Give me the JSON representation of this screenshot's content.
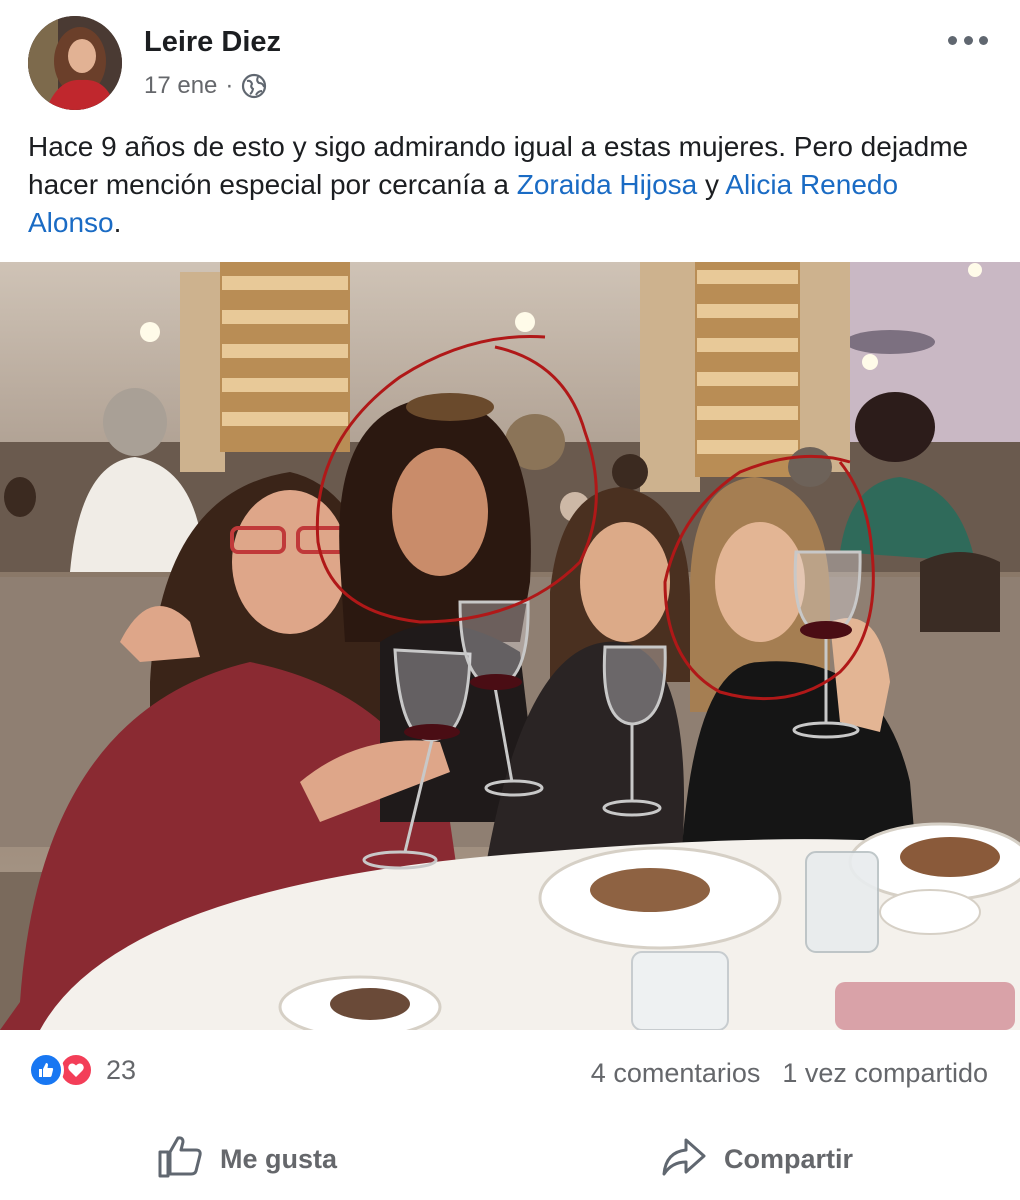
{
  "post": {
    "author": "Leire Diez",
    "date": "17 ene",
    "separator": "·",
    "privacy_icon": "globe-icon",
    "menu_icon": "more-options-icon",
    "text_before": "Hace 9 años de esto y sigo admirando igual a estas mujeres. Pero dejadme hacer mención especial por cercanía a ",
    "mention_1": "Zoraida Hijosa",
    "text_between": " y ",
    "mention_2": "Alicia Renedo Alonso",
    "text_after": "."
  },
  "reactions": {
    "icons": [
      "like-icon",
      "love-icon"
    ],
    "count": "23",
    "comments": "4 comentarios",
    "shares": "1 vez compartido"
  },
  "actions": {
    "like_label": "Me gusta",
    "share_label": "Compartir"
  },
  "colors": {
    "mention": "#1a6bc4",
    "like_blue": "#1877f2",
    "love_red": "#f33e58",
    "secondary_text": "#65676b",
    "annotation_circle": "#b01818"
  }
}
